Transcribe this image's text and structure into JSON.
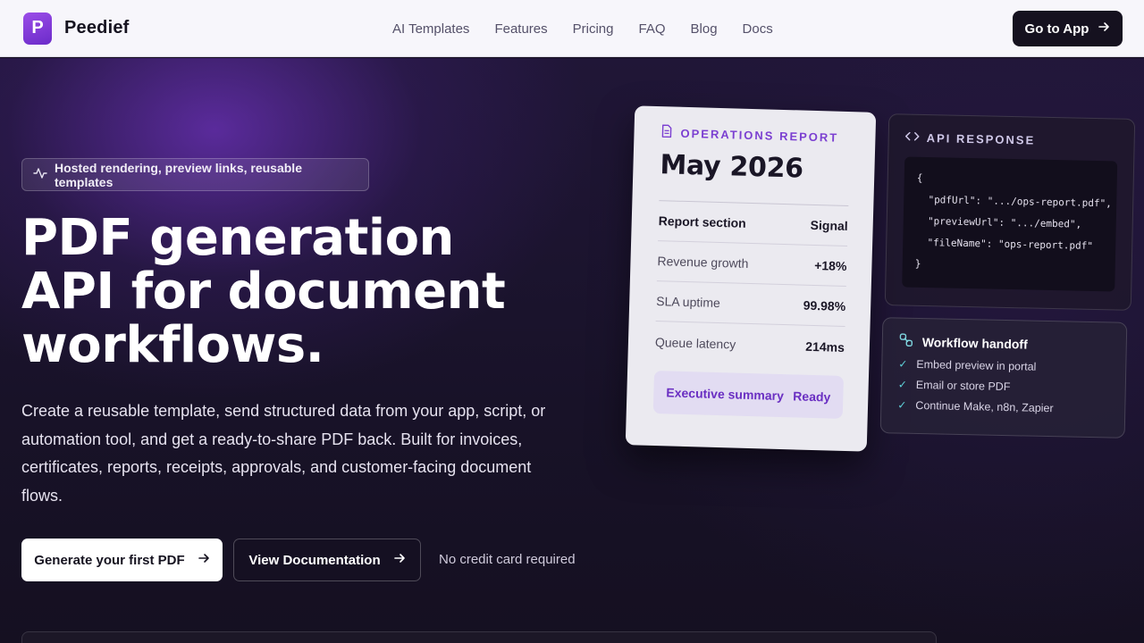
{
  "nav": {
    "logo_letter": "P",
    "brand": "Peedief",
    "links": [
      "AI Templates",
      "Features",
      "Pricing",
      "FAQ",
      "Blog",
      "Docs"
    ],
    "cta": "Go to App"
  },
  "hero": {
    "pill": "Hosted rendering, preview links, reusable templates",
    "headline": [
      "PDF generation",
      "API for document",
      "workflows."
    ],
    "description": "Create a reusable template, send structured data from your app, script, or automation tool, and get a ready-to-share PDF back. Built for invoices, certificates, reports, receipts, approvals, and customer-facing document flows.",
    "primary_cta": "Generate your first PDF",
    "secondary_cta": "View Documentation",
    "note": "No credit card required"
  },
  "report_card": {
    "label": "OPERATIONS REPORT",
    "title": "May 2026",
    "header": {
      "label": "Report section",
      "value": "Signal"
    },
    "rows": [
      {
        "label": "Revenue growth",
        "value": "+18%"
      },
      {
        "label": "SLA uptime",
        "value": "99.98%"
      },
      {
        "label": "Queue latency",
        "value": "214ms"
      }
    ],
    "summary": {
      "label": "Executive summary",
      "value": "Ready"
    }
  },
  "api_card": {
    "label": "API RESPONSE",
    "lines": [
      "{",
      "  \"pdfUrl\": \".../ops-report.pdf\",",
      "  \"previewUrl\": \".../embed\",",
      "  \"fileName\": \"ops-report.pdf\"",
      "}"
    ]
  },
  "workflow_card": {
    "title": "Workflow handoff",
    "items": [
      "Embed preview in portal",
      "Email or store PDF",
      "Continue Make, n8n, Zapier"
    ]
  },
  "icons": {
    "pill": "activity-icon",
    "report": "document-icon",
    "api": "code-icon",
    "workflow": "link-icon",
    "check": "check-icon",
    "arrow": "arrow-right-icon"
  },
  "colors": {
    "accent": "#7b3fd1",
    "background": "#15101f",
    "nav_bg": "#f7f6fb"
  }
}
